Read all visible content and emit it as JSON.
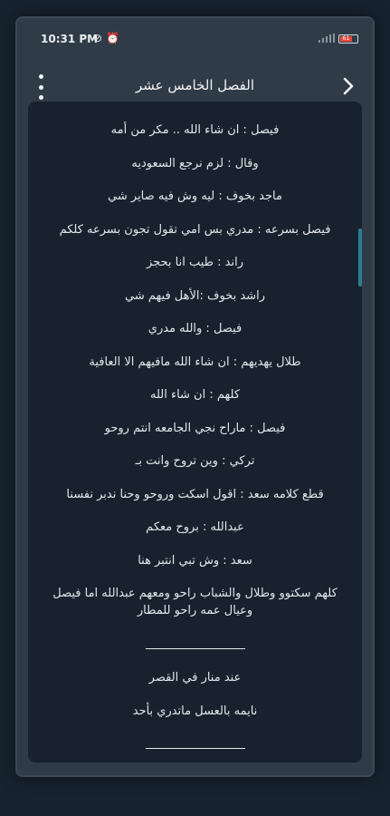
{
  "status": {
    "time": "10:31 PM",
    "battery": "61"
  },
  "header": {
    "title": "الفصل الخامس عشر"
  },
  "content": {
    "lines": [
      "فيصل : ان شاء الله .. مكر من أمه",
      "وقال : لزم نرجع السعوديه",
      "ماجد بخوف : ليه وش فيه صاير شي",
      "فيصل بسرعه : مدري بس امي تقول تجون بسرعه كلكم",
      "راند : طيب انا بحجز",
      "راشد بخوف :الأهل فيهم شي",
      "فيصل : والله مدري",
      "طلال يهديهم : ان شاء الله مافيهم الا العافية",
      "كلهم : ان شاء الله",
      "فيصل : ماراح نجي الجامعه انتم روحو",
      "تركي : وين تروح وانت بـ",
      "قطع كلامه سعد : اقول اسكت وروحو وحنا ندبر نفسنا",
      "عبدالله : بروح معكم",
      "سعد : وش تبي انتبر هنا",
      "كلهم سكتوو وطلال والشباب راحو ومعهم عبدالله اما فيصل وعيال عمه راحو للمطار"
    ],
    "next_chapter_lines": [
      "عند منار في القصر",
      "نايمه بالعسل ماتدري بأحد"
    ]
  }
}
